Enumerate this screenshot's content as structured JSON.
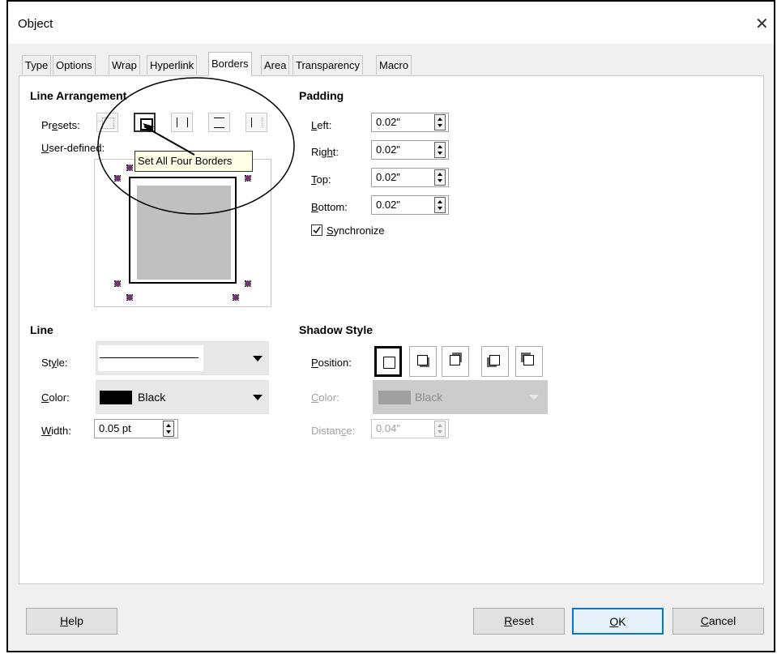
{
  "window": {
    "title": "Object",
    "close_label": "✕"
  },
  "tabs": [
    "Type",
    "Options",
    "Wrap",
    "Hyperlink",
    "Borders",
    "Area",
    "Transparency",
    "Macro"
  ],
  "active_tab": "Borders",
  "line_arrangement": {
    "heading": "Line Arrangement",
    "presets_label": "Presets:",
    "user_defined_label": "User-defined:",
    "tooltip": "Set All Four Borders"
  },
  "padding": {
    "heading": "Padding",
    "left_label": "Left:",
    "left_value": "0.02\"",
    "right_label": "Right:",
    "right_value": "0.02\"",
    "top_label": "Top:",
    "top_value": "0.02\"",
    "bottom_label": "Bottom:",
    "bottom_value": "0.02\"",
    "synchronize_label": "Synchronize",
    "synchronize_checked": true
  },
  "line": {
    "heading": "Line",
    "style_label": "Style:",
    "color_label": "Color:",
    "color_value": "Black",
    "color_swatch": "#000000",
    "width_label": "Width:",
    "width_value": "0.05 pt"
  },
  "shadow": {
    "heading": "Shadow Style",
    "position_label": "Position:",
    "color_label": "Color:",
    "color_value": "Black",
    "color_swatch": "#a0a0a0",
    "distance_label": "Distance:",
    "distance_value": "0.04\""
  },
  "buttons": {
    "help": "Help",
    "reset": "Reset",
    "ok": "OK",
    "cancel": "Cancel"
  }
}
